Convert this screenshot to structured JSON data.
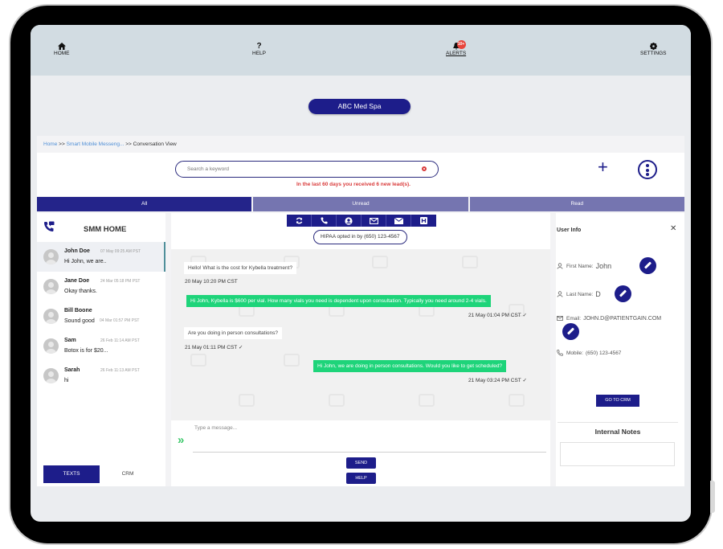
{
  "nav": {
    "items": [
      {
        "label": "HOME",
        "icon": "home-icon"
      },
      {
        "label": "HELP",
        "icon": "question-icon"
      },
      {
        "label": "ALERTS",
        "icon": "bell-icon",
        "badge": "10+"
      },
      {
        "label": "SETTINGS",
        "icon": "gear-icon"
      }
    ]
  },
  "org": {
    "label": "ABC Med Spa"
  },
  "breadcrumb": {
    "home": "Home",
    "sep1": ">>",
    "smm": "Smart Mobile Messeng...",
    "sep2": ">>",
    "current": "Conversation View"
  },
  "search": {
    "placeholder": "Search a keyword",
    "value": "",
    "leads_message": "In the last 60 days you received 6 new lead(s)."
  },
  "actions": {
    "add": "+"
  },
  "tabs": [
    {
      "label": "All",
      "active": true
    },
    {
      "label": "Unread",
      "active": false
    },
    {
      "label": "Read",
      "active": false
    }
  ],
  "list": {
    "title": "SMM HOME",
    "conversations": [
      {
        "name": "John Doe",
        "time": "07 May 09:25 AM PST",
        "preview": "Hi John, we are..",
        "active": true
      },
      {
        "name": "Jane Doe",
        "time": "24 Mar 05:18 PM PST",
        "preview": "Okay thanks."
      },
      {
        "name": "Bill Boone",
        "time": "04 Mar 01:57 PM PST",
        "preview": "Sound good"
      },
      {
        "name": "Sam",
        "time": "26 Feb 11:14 AM PST",
        "preview": "Botox is for $20..."
      },
      {
        "name": "Sarah",
        "time": "26 Feb 11:13 AM PST",
        "preview": "hi"
      }
    ],
    "bottom_tabs": [
      {
        "label": "TEXTS",
        "active": true
      },
      {
        "label": "CRM",
        "active": false
      }
    ]
  },
  "chat": {
    "tools": [
      "refresh-icon",
      "phone-icon",
      "user-circle-icon",
      "email-outline-icon",
      "email-filled-icon",
      "hospital-icon"
    ],
    "hipaa": "HIPAA opted in by (650) 123-4567",
    "messages": [
      {
        "dir": "in",
        "text": "Hello! What is the cost for Kybella treatment?",
        "time": "20 May 10:20 PM CST"
      },
      {
        "dir": "out",
        "text": "Hi John, Kybella is $600 per vial. How many vials you need is dependent upon consultation. Typically you need around 2-4 vials.",
        "time": "21 May 01:04 PM CST ✓"
      },
      {
        "dir": "in",
        "text": "Are you doing in person consultations?",
        "time": "21 May 01:11 PM CST ✓"
      },
      {
        "dir": "out",
        "text": "Hi John, we are doing in person consultations. Would you like to get scheduled?",
        "time": "21 May 03:24 PM CST ✓"
      }
    ],
    "compose_placeholder": "Type a message...",
    "send_label": "SEND",
    "help_label": "HELP"
  },
  "user_info": {
    "title": "User Info",
    "first_name_label": "First Name:",
    "first_name": "John",
    "last_name_label": "Last Name:",
    "last_name": "D",
    "email_label": "Email:",
    "email": "JOHN.D@PATIENTGAIN.COM",
    "mobile_label": "Mobile:",
    "mobile": "(650) 123-4567",
    "crm_button": "GO TO CRM",
    "notes_title": "Internal Notes"
  },
  "colors": {
    "primary": "#1d1d8a",
    "tab_inactive": "#7575b0",
    "outgoing_bubble": "#1ed47a",
    "alert_red": "#d93a3a",
    "link": "#4f8fd6"
  }
}
